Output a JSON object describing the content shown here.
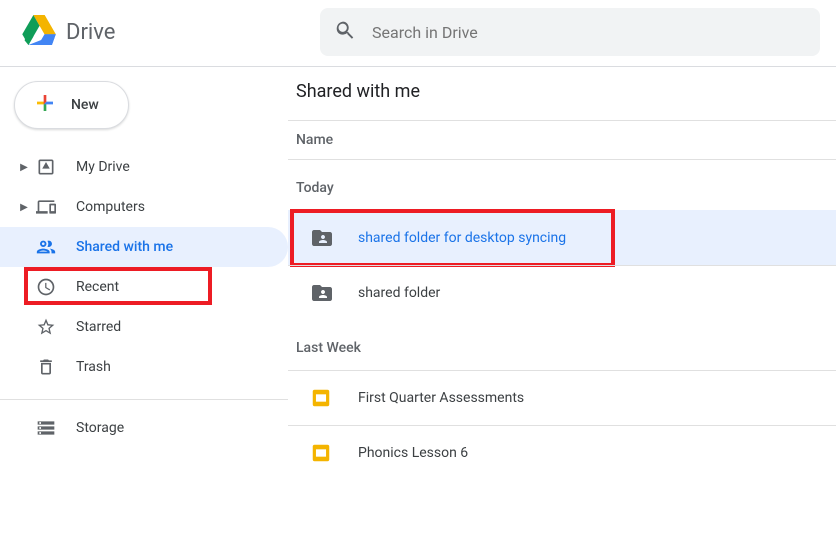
{
  "brand": "Drive",
  "search": {
    "placeholder": "Search in Drive"
  },
  "newButton": "New",
  "sidebar": {
    "items": [
      {
        "label": "My Drive"
      },
      {
        "label": "Computers"
      },
      {
        "label": "Shared with me"
      },
      {
        "label": "Recent"
      },
      {
        "label": "Starred"
      },
      {
        "label": "Trash"
      }
    ],
    "storage": "Storage"
  },
  "content": {
    "title": "Shared with me",
    "columnHeader": "Name",
    "sections": [
      {
        "label": "Today",
        "files": [
          {
            "name": "shared folder for desktop syncing"
          },
          {
            "name": "shared folder"
          }
        ]
      },
      {
        "label": "Last Week",
        "files": [
          {
            "name": "First Quarter Assessments"
          },
          {
            "name": "Phonics Lesson 6"
          }
        ]
      }
    ]
  }
}
